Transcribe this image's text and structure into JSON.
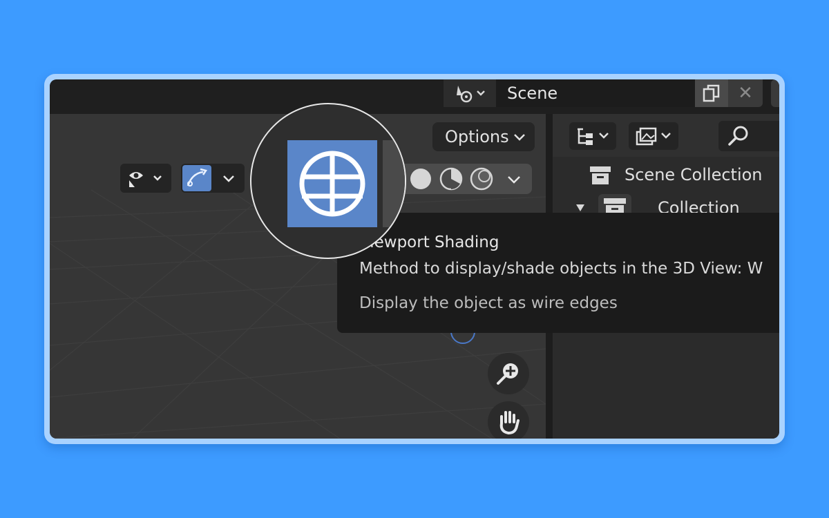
{
  "scene_selector": {
    "name": "Scene",
    "type_icon": "scene-data-icon",
    "copy_icon": "copy-scene-icon",
    "close_icon": "close-icon"
  },
  "viewport_header": {
    "options_label": "Options",
    "visibility_icon": "eye-visibility-icon",
    "gizmo_icon": "gizmo-icon",
    "shading_buttons": [
      "wireframe-shading-icon",
      "solid-shading-icon",
      "material-preview-icon",
      "rendered-shading-icon"
    ],
    "active_shading": "Wireframe"
  },
  "outliner": {
    "display_mode_icon": "outliner-display-mode-icon",
    "filter_icon": "outliner-filter-icon",
    "search_icon": "search-icon",
    "items": [
      {
        "label": "Scene Collection",
        "icon": "collection-icon"
      },
      {
        "label": "Collection",
        "icon": "collection-icon"
      }
    ]
  },
  "tooltip": {
    "title": "Viewport Shading",
    "description": "Method to display/shade objects in the 3D View:  W",
    "detail": "Display the object as wire edges"
  },
  "navigation": {
    "zoom_icon": "zoom-in-icon",
    "pan_icon": "hand-pan-icon"
  },
  "colors": {
    "background": "#3d9bff",
    "accent_active": "#5a86c9",
    "panel": "#303030",
    "tooltip": "#1b1b1b"
  }
}
